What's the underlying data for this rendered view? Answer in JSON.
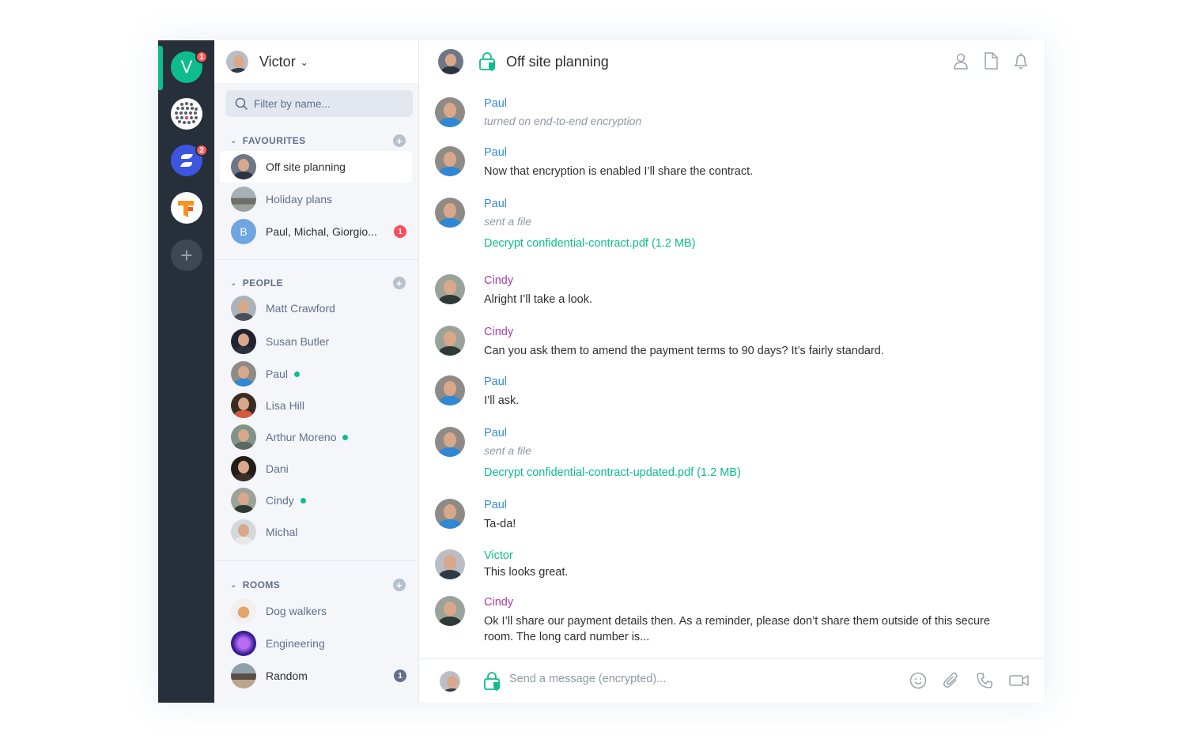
{
  "rail": {
    "home_initial": "V",
    "home_badge": "1",
    "space2_badge": "2",
    "add_label": "+"
  },
  "roomlist": {
    "user_name": "Victor",
    "filter_placeholder": "Filter by name...",
    "favourites": {
      "title": "FAVOURITES",
      "rooms": [
        {
          "name": "Off site planning"
        },
        {
          "name": "Holiday plans"
        },
        {
          "name": "Paul, Michal, Giorgio...",
          "initial": "B",
          "badge": "1"
        }
      ]
    },
    "people": {
      "title": "PEOPLE",
      "rooms": [
        {
          "name": "Matt Crawford"
        },
        {
          "name": "Susan Butler"
        },
        {
          "name": "Paul"
        },
        {
          "name": "Lisa Hill"
        },
        {
          "name": "Arthur Moreno"
        },
        {
          "name": "Dani"
        },
        {
          "name": "Cindy"
        },
        {
          "name": "Michal"
        }
      ]
    },
    "rooms": {
      "title": "ROOMS",
      "rooms": [
        {
          "name": "Dog walkers"
        },
        {
          "name": "Engineering"
        },
        {
          "name": "Random",
          "badge": "1"
        }
      ]
    }
  },
  "room": {
    "title": "Off site planning"
  },
  "messages": [
    {
      "sender": "Paul",
      "notice": "turned on end-to-end encryption"
    },
    {
      "sender": "Paul",
      "body": "Now that encryption is enabled I’ll share the contract."
    },
    {
      "sender": "Paul",
      "notice": "sent a file",
      "file": "Decrypt confidential-contract.pdf (1.2 MB)"
    },
    {
      "sender": "Cindy",
      "body": "Alright I’ll take a look."
    },
    {
      "sender": "Cindy",
      "body": "Can you ask them to amend the payment terms to 90 days? It’s fairly standard."
    },
    {
      "sender": "Paul",
      "body": "I’ll ask."
    },
    {
      "sender": "Paul",
      "notice": "sent a file",
      "file": "Decrypt confidential-contract-updated.pdf (1.2 MB)"
    },
    {
      "sender": "Paul",
      "body": "Ta-da!"
    },
    {
      "sender": "Victor",
      "body": "This looks great."
    },
    {
      "sender": "Cindy",
      "body_line1": "Ok I’ll share our payment details then. As a reminder, please don’t share them outside of this secure",
      "body_line2": "room. The long card number is..."
    }
  ],
  "composer": {
    "placeholder": "Send a message (encrypted)..."
  },
  "icons": {
    "header": [
      "person-icon",
      "file-icon",
      "bell-icon"
    ],
    "composer": [
      "emoji-icon",
      "paperclip-icon",
      "phone-icon",
      "video-icon"
    ]
  },
  "colors": {
    "accent": "#0dbd8b",
    "rail": "#27303a",
    "paul": "#368bd6",
    "cindy": "#ac3ba8",
    "badge": "#ff4b55"
  }
}
